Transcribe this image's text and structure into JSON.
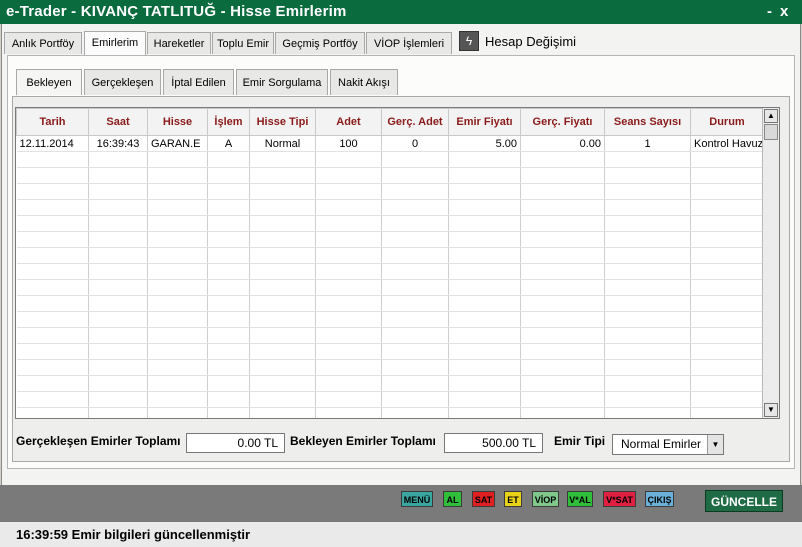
{
  "window": {
    "title": "e-Trader - KIVANÇ TATLITUĞ - Hisse Emirlerim",
    "minimize": "-",
    "close": "x"
  },
  "top_tabs": [
    {
      "label": "Anlık Portföy",
      "active": false
    },
    {
      "label": "Emirlerim",
      "active": true
    },
    {
      "label": "Hareketler",
      "active": false
    },
    {
      "label": "Toplu Emir",
      "active": false
    },
    {
      "label": "Geçmiş Portföy",
      "active": false
    },
    {
      "label": "VİOP İşlemleri",
      "active": false
    }
  ],
  "account_change": {
    "label": "Hesap Değişimi",
    "icon": "lightning-icon"
  },
  "sub_tabs": [
    {
      "label": "Bekleyen",
      "active": true
    },
    {
      "label": "Gerçekleşen",
      "active": false
    },
    {
      "label": "İptal Edilen",
      "active": false
    },
    {
      "label": "Emir Sorgulama",
      "active": false
    },
    {
      "label": "Nakit Akışı",
      "active": false
    }
  ],
  "table": {
    "columns": [
      "Tarih",
      "Saat",
      "Hisse",
      "İşlem",
      "Hisse Tipi",
      "Adet",
      "Gerç. Adet",
      "Emir Fiyatı",
      "Gerç. Fiyatı",
      "Seans Sayısı",
      "Durum"
    ],
    "rows": [
      [
        "12.11.2014",
        "16:39:43",
        "GARAN.E",
        "A",
        "Normal",
        "100",
        "0",
        "5.00",
        "0.00",
        "1",
        "Kontrol Havuz"
      ]
    ]
  },
  "footer": {
    "executed_total_label": "Gerçekleşen Emirler Toplamı",
    "executed_total_value": "0.00 TL",
    "pending_total_label": "Bekleyen Emirler Toplamı",
    "pending_total_value": "500.00 TL",
    "order_type_label": "Emir Tipi",
    "order_type_value": "Normal Emirler"
  },
  "bottom_buttons": [
    {
      "label": "MENÜ",
      "color": "#3aa6a0"
    },
    {
      "label": "AL",
      "color": "#2fbf3a"
    },
    {
      "label": "SAT",
      "color": "#e02020"
    },
    {
      "label": "ET",
      "color": "#e8d21a"
    },
    {
      "label": "VİOP",
      "color": "#7fc88a"
    },
    {
      "label": "V*AL",
      "color": "#2fbf3a"
    },
    {
      "label": "V*SAT",
      "color": "#e02040"
    },
    {
      "label": "ÇIKIŞ",
      "color": "#6ab0d8"
    }
  ],
  "refresh_button": "GÜNCELLE",
  "status_message": "16:39:59 Emir bilgileri güncellenmiştir"
}
